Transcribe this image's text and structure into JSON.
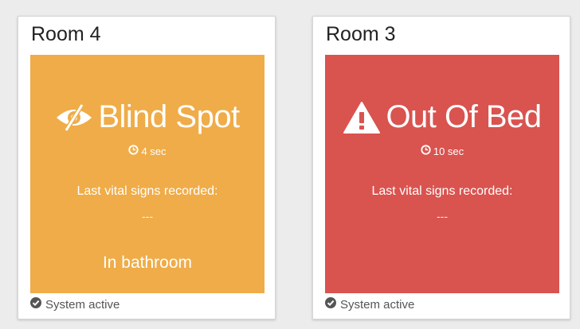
{
  "cards": [
    {
      "room": "Room 4",
      "alert": "Blind Spot",
      "alert_icon": "blind-spot-icon",
      "color": "#efac48",
      "timer": "4 sec",
      "vitals_label": "Last vital signs recorded:",
      "vitals_value": "---",
      "location": "In bathroom",
      "system_status": "System active"
    },
    {
      "room": "Room 3",
      "alert": "Out Of Bed",
      "alert_icon": "warning-icon",
      "color": "#d9534f",
      "timer": "10 sec",
      "vitals_label": "Last vital signs recorded:",
      "vitals_value": "---",
      "location": "",
      "system_status": "System active"
    }
  ]
}
